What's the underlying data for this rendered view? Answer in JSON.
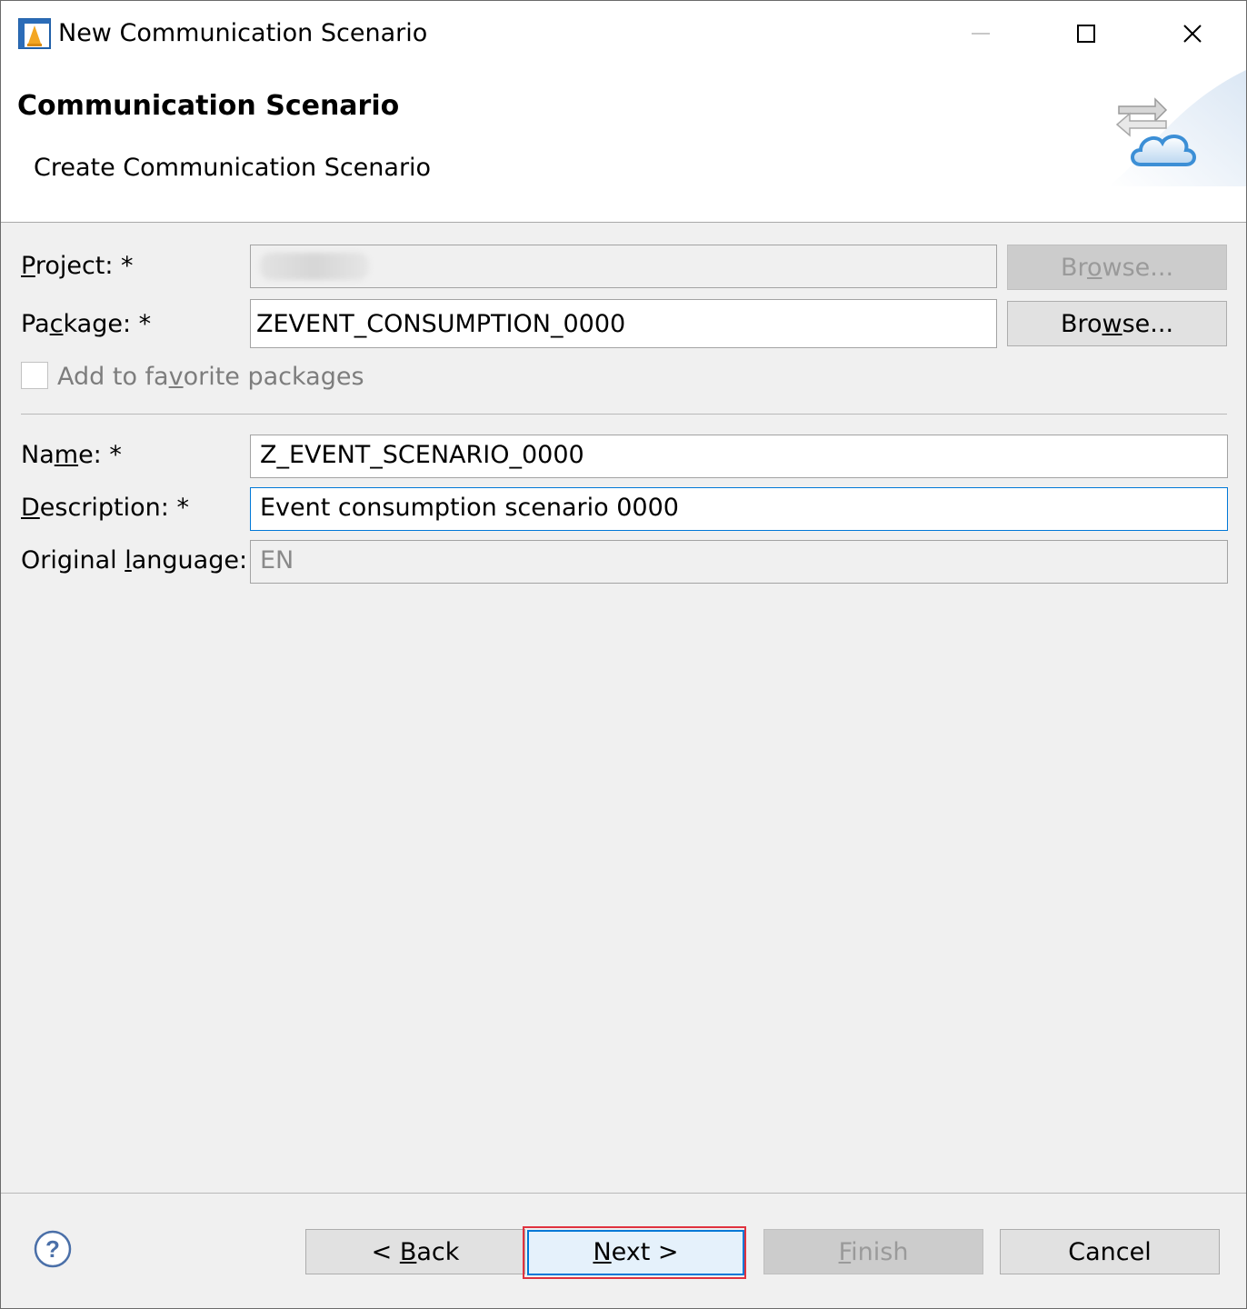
{
  "window": {
    "title": "New Communication Scenario",
    "controls": [
      "minimize",
      "maximize",
      "close"
    ]
  },
  "header": {
    "title": "Communication Scenario",
    "description": "Create Communication Scenario"
  },
  "form": {
    "project": {
      "label_pre": "",
      "label_mnemonic": "P",
      "label_post": "roject: *",
      "value": ""
    },
    "package": {
      "label_pre": "Pa",
      "label_mnemonic": "c",
      "label_post": "kage: *",
      "value": "ZEVENT_CONSUMPTION_0000"
    },
    "browse_project": {
      "pre": "Br",
      "mnemonic": "o",
      "post": "wse..."
    },
    "browse_package": {
      "pre": "Bro",
      "mnemonic": "w",
      "post": "se..."
    },
    "favorite": {
      "pre": "Add to fa",
      "mnemonic": "v",
      "post": "orite packages",
      "checked": false
    },
    "name": {
      "label_pre": "Na",
      "label_mnemonic": "m",
      "label_post": "e: *",
      "value": "Z_EVENT_SCENARIO_0000"
    },
    "description": {
      "label_pre": "",
      "label_mnemonic": "D",
      "label_post": "escription: *",
      "value": "Event consumption scenario 0000"
    },
    "original_language": {
      "label_pre": "Original ",
      "label_mnemonic": "l",
      "label_post": "anguage:",
      "value": "EN"
    }
  },
  "buttons": {
    "back": {
      "pre": "< ",
      "mnemonic": "B",
      "post": "ack"
    },
    "next": {
      "pre": "",
      "mnemonic": "N",
      "post": "ext >"
    },
    "finish": {
      "pre": "",
      "mnemonic": "F",
      "post": "inish"
    },
    "cancel": "Cancel"
  },
  "icons": {
    "app": "eclipse-app-icon",
    "header": "communication-cloud-icon",
    "help": "help-icon"
  },
  "colors": {
    "focus_border": "#0078d7",
    "highlight": "#e0323f",
    "dialog_bg": "#f0f0f0"
  }
}
